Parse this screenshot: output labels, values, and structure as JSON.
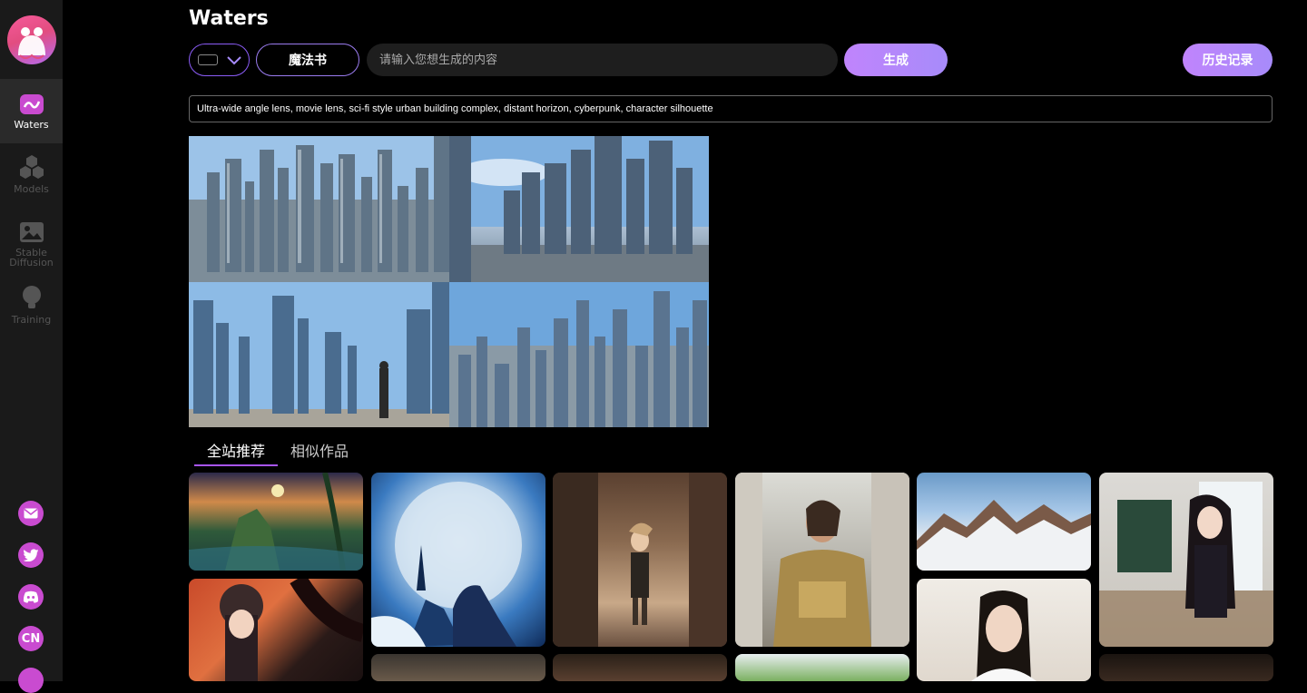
{
  "app": {
    "title": "Waters"
  },
  "sidebar": {
    "items": [
      {
        "label": "Waters",
        "icon": "waters-icon",
        "active": true
      },
      {
        "label": "Models",
        "icon": "models-icon",
        "active": false
      },
      {
        "label": "Stable Diffusion",
        "label_line1": "Stable",
        "label_line2": "Diffusion",
        "icon": "image-icon",
        "active": false
      },
      {
        "label": "Training",
        "icon": "lightbulb-icon",
        "active": false
      }
    ],
    "social": [
      "mail-icon",
      "twitter-icon",
      "discord-icon",
      "language-cn-icon",
      "more-icon"
    ],
    "cn_label": "CN"
  },
  "toolbar": {
    "spellbook_label": "魔法书",
    "prompt_placeholder": "请输入您想生成的内容",
    "generate_label": "生成",
    "history_label": "历史记录"
  },
  "prompt": {
    "text": "Ultra-wide angle lens, movie lens, sci-fi style urban building complex, distant horizon, cyberpunk, character silhouette"
  },
  "gallery": {
    "tabs": [
      {
        "label": "全站推荐",
        "active": true
      },
      {
        "label": "相似作品",
        "active": false
      }
    ]
  },
  "colors": {
    "accent": "#a855f7",
    "button_gradient_start": "#c084fc",
    "button_gradient_end": "#a78bfa",
    "sidebar_bg": "#1a1a1a",
    "social_icon": "#c94bd0"
  }
}
